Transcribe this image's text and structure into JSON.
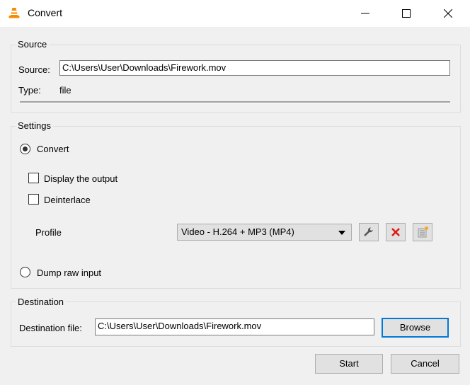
{
  "window": {
    "title": "Convert",
    "app_icon": "vlc-cone-icon",
    "controls": {
      "minimize": "minimize-icon",
      "maximize": "maximize-icon",
      "close": "close-icon"
    }
  },
  "source": {
    "group_title": "Source",
    "source_label": "Source:",
    "source_value": "C:\\Users\\User\\Downloads\\Firework.mov",
    "type_label": "Type:",
    "type_value": "file"
  },
  "settings": {
    "group_title": "Settings",
    "convert_label": "Convert",
    "convert_selected": true,
    "display_output_label": "Display the output",
    "display_output_checked": false,
    "deinterlace_label": "Deinterlace",
    "deinterlace_checked": false,
    "profile_label": "Profile",
    "profile_selected": "Video - H.264 + MP3 (MP4)",
    "profile_buttons": [
      "edit-profile (wrench-icon)",
      "delete-profile (red-x-icon)",
      "new-profile (list-star-icon)"
    ],
    "dump_raw_label": "Dump raw input",
    "dump_raw_selected": false
  },
  "destination": {
    "group_title": "Destination",
    "file_label": "Destination file:",
    "file_value": "C:\\Users\\User\\Downloads\\Firework.mov",
    "browse_label": "Browse"
  },
  "footer": {
    "start_label": "Start",
    "cancel_label": "Cancel"
  }
}
